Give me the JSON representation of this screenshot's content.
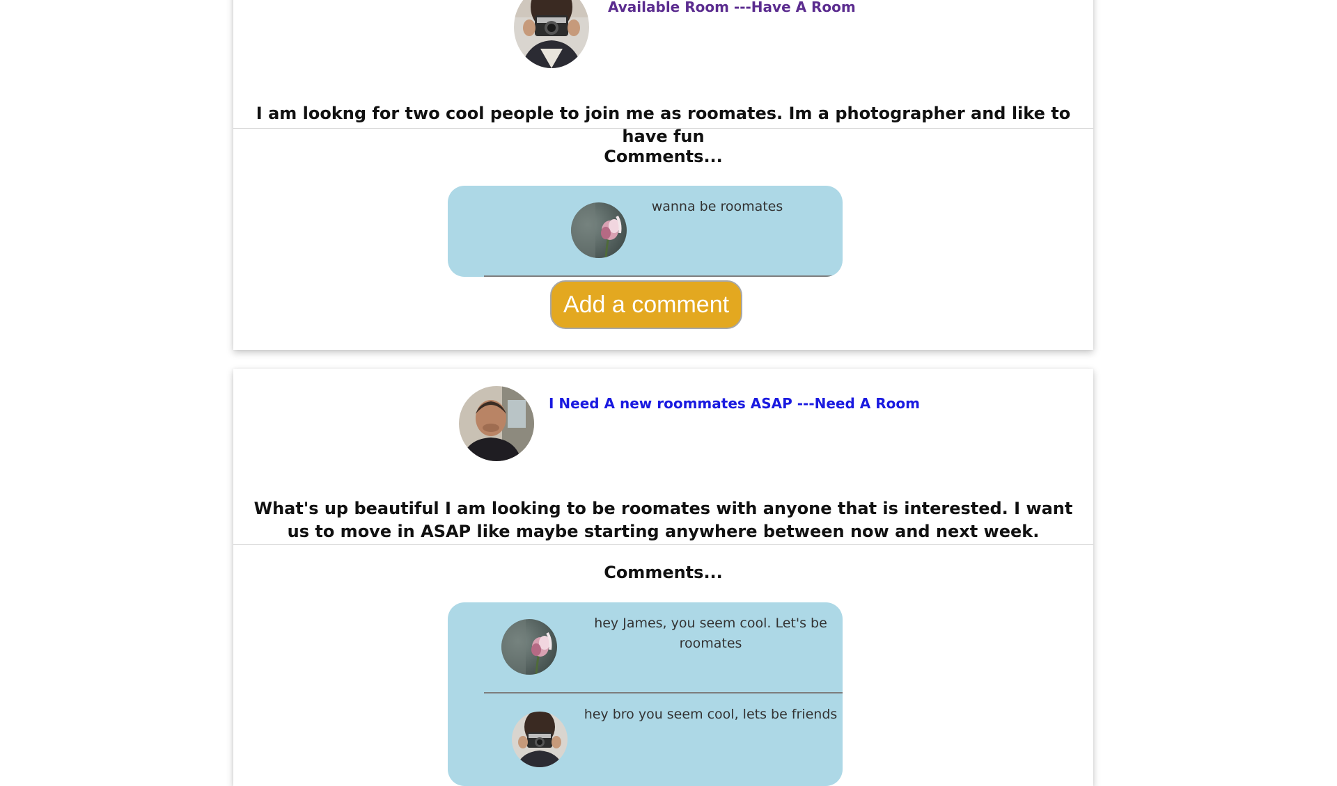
{
  "posts": [
    {
      "title": "Available Room ---Have A Room",
      "title_color": "#5b2c8f",
      "body": "I am lookng for two cool people to join me as roomates. Im a photographer and like to have fun",
      "comments_heading": "Comments...",
      "comments": [
        {
          "text": "wanna be roomates",
          "avatar": "flower-avatar"
        }
      ],
      "add_comment_label": "Add a comment"
    },
    {
      "title": "I Need A new roommates ASAP ---Need A Room",
      "title_color": "#1a1ae0",
      "body": "What's up beautiful I am looking to be roomates with anyone that is interested. I want us to move in ASAP like maybe starting anywhere between now and next week.",
      "comments_heading": "Comments...",
      "comments": [
        {
          "text": "hey James, you seem cool. Let's be roomates",
          "avatar": "flower-avatar"
        },
        {
          "text": "hey bro you seem cool, lets be friends",
          "avatar": "camera-avatar"
        }
      ]
    }
  ]
}
